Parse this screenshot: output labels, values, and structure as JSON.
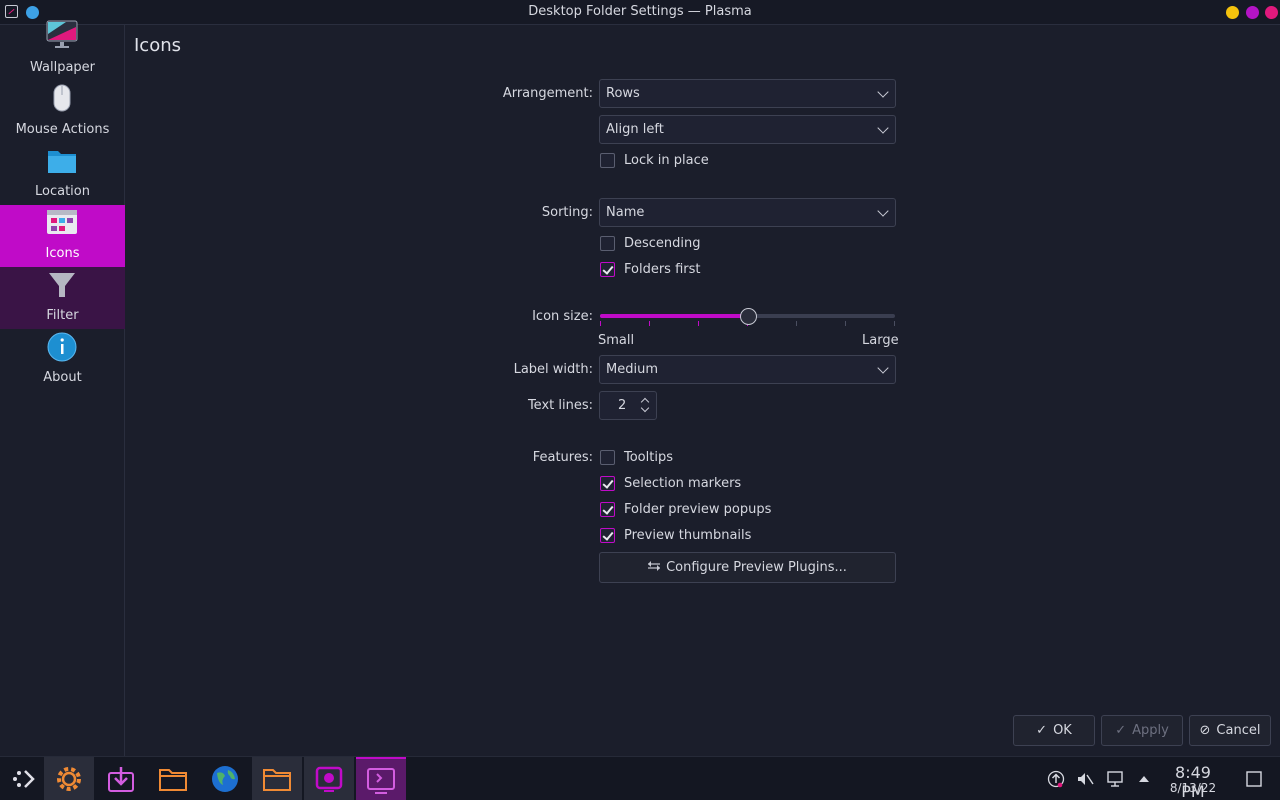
{
  "window": {
    "title": "Desktop Folder Settings — Plasma"
  },
  "sidebar": {
    "items": [
      {
        "label": "Wallpaper",
        "icon": "wallpaper-icon"
      },
      {
        "label": "Mouse Actions",
        "icon": "mouse-icon"
      },
      {
        "label": "Location",
        "icon": "folder-icon"
      },
      {
        "label": "Icons",
        "icon": "icons-icon",
        "active": true
      },
      {
        "label": "Filter",
        "icon": "filter-icon"
      },
      {
        "label": "About",
        "icon": "info-icon"
      }
    ]
  },
  "page": {
    "title": "Icons"
  },
  "arrangement": {
    "label": "Arrangement:",
    "value": "Rows",
    "alignment": "Align left",
    "lock_label": "Lock in place",
    "lock_checked": false
  },
  "sorting": {
    "label": "Sorting:",
    "value": "Name",
    "descending_label": "Descending",
    "descending_checked": false,
    "folders_first_label": "Folders first",
    "folders_first_checked": true
  },
  "icon_size": {
    "label": "Icon size:",
    "min_label": "Small",
    "max_label": "Large",
    "level": 0.5,
    "ticks": 7
  },
  "label_width": {
    "label": "Label width:",
    "value": "Medium"
  },
  "text_lines": {
    "label": "Text lines:",
    "value": "2"
  },
  "features": {
    "label": "Features:",
    "tooltips_label": "Tooltips",
    "tooltips_checked": false,
    "selection_markers_label": "Selection markers",
    "selection_markers_checked": true,
    "folder_preview_label": "Folder preview popups",
    "folder_preview_checked": true,
    "preview_thumbnails_label": "Preview thumbnails",
    "preview_thumbnails_checked": true,
    "configure_button": "Configure Preview Plugins..."
  },
  "dialog_buttons": {
    "ok": "OK",
    "apply": "Apply",
    "cancel": "Cancel"
  },
  "taskbar": {
    "time": "8:49 PM",
    "date": "8/13/22"
  },
  "colors": {
    "accent": "#c00bc8",
    "background": "#1b1e2b",
    "text": "#d6d8e0"
  }
}
